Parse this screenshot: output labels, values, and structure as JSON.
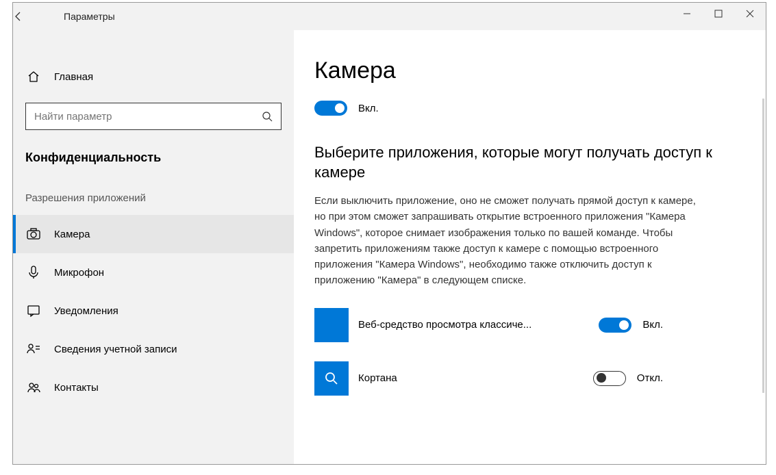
{
  "titlebar": {
    "title": "Параметры"
  },
  "sidebar": {
    "home": "Главная",
    "search_placeholder": "Найти параметр",
    "category": "Конфиденциальность",
    "group": "Разрешения приложений",
    "items": [
      {
        "label": "Камера"
      },
      {
        "label": "Микрофон"
      },
      {
        "label": "Уведомления"
      },
      {
        "label": "Сведения учетной записи"
      },
      {
        "label": "Контакты"
      }
    ]
  },
  "content": {
    "page_title": "Камера",
    "main_toggle": {
      "label": "Вкл.",
      "state": "on"
    },
    "sub_heading": "Выберите приложения, которые могут получать доступ к камере",
    "description": "Если выключить приложение, оно не сможет получать прямой доступ к камере, но при этом сможет запрашивать открытие встроенного приложения \"Камера Windows\", которое снимает изображения только по вашей команде. Чтобы запретить приложениям также доступ к камере с помощью встроенного приложения \"Камера Windows\", необходимо также отключить доступ к приложению \"Камера\" в следующем списке.",
    "apps": [
      {
        "name": "Веб-средство просмотра классиче...",
        "toggle_label": "Вкл.",
        "state": "on",
        "icon": "blank"
      },
      {
        "name": "Кортана",
        "toggle_label": "Откл.",
        "state": "off",
        "icon": "search"
      }
    ]
  }
}
